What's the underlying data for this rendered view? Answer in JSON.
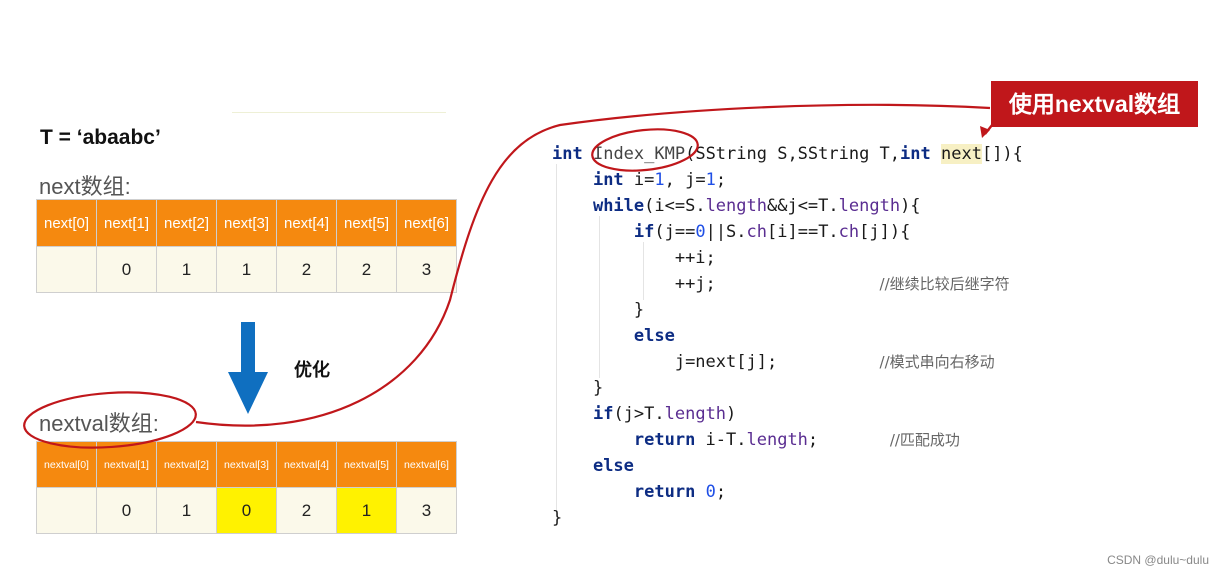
{
  "t_string": "T = ‘abaabc’",
  "next_array": {
    "label": "next数组:",
    "headers": [
      "next[0]",
      "next[1]",
      "next[2]",
      "next[3]",
      "next[4]",
      "next[5]",
      "next[6]"
    ],
    "values": [
      "",
      "0",
      "1",
      "1",
      "2",
      "2",
      "3"
    ],
    "highlight": [
      false,
      false,
      false,
      false,
      false,
      false,
      false
    ]
  },
  "optimize_label": "优化",
  "nextval_array": {
    "label": "nextval数组:",
    "headers": [
      "nextval[0]",
      "nextval[1]",
      "nextval[2]",
      "nextval[3]",
      "nextval[4]",
      "nextval[5]",
      "nextval[6]"
    ],
    "values": [
      "",
      "0",
      "1",
      "0",
      "2",
      "1",
      "3"
    ],
    "highlight": [
      false,
      false,
      false,
      true,
      false,
      true,
      false
    ]
  },
  "callout_tag": "使用nextval数组",
  "code": {
    "sig_int": "int",
    "sig_fn": "Index_KMP",
    "sig_mid": "(SString S,SString T,",
    "sig_int2": "int",
    "sig_next": "next",
    "sig_end": "[]){",
    "l2_kw": "int",
    "l2_a": " i=",
    "l2_n1": "1",
    "l2_b": ", j=",
    "l2_n2": "1",
    "l2_c": ";",
    "l3_kw": "while",
    "l3_a": "(i<=S.",
    "l3_v1": "length",
    "l3_b": "&&j<=T.",
    "l3_v2": "length",
    "l3_c": "){",
    "l4_kw": "if",
    "l4_a": "(j==",
    "l4_n": "0",
    "l4_b": "||S.",
    "l4_v1": "ch",
    "l4_c": "[i]==T.",
    "l4_v2": "ch",
    "l4_d": "[j]){",
    "l5": "++i;",
    "l6": "++j;",
    "l6_cmt": "//继续比较后继字符",
    "l7": "}",
    "l8_kw": "else",
    "l9": "j=next[j];",
    "l9_cmt": "//模式串向右移动",
    "l10": "}",
    "l11_kw": "if",
    "l11_a": "(j>T.",
    "l11_v": "length",
    "l11_b": ")",
    "l12_kw": "return",
    "l12_a": " i-T.",
    "l12_v": "length",
    "l12_b": ";",
    "l12_cmt": "//匹配成功",
    "l13_kw": "else",
    "l14_kw": "return",
    "l14_n": "0",
    "l14_b": ";",
    "l15": "}"
  },
  "watermark": "CSDN @dulu~dulu",
  "colors": {
    "header_orange": "#f5890f",
    "cell_bg": "#fbf9ea",
    "highlight_yellow": "#fff200",
    "annotation_red": "#c0171b",
    "arrow_blue": "#0f6fc0",
    "keyword_blue": "#0d2c83"
  }
}
